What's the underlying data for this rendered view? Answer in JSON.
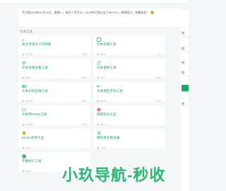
{
  "notice": {
    "text": "今天是2025年07月21日，星期一，农历六月廿七，2025年已经过去了55.07%，继续努力，把握机会！"
  },
  "section": {
    "title": "文本工具"
  },
  "cards": [
    {
      "title": "英文字母大小写转换",
      "views": "117111",
      "likes": "7994"
    },
    {
      "title": "文本去重工具",
      "views": "15941",
      "likes": "6..."
    },
    {
      "title": "文本去重合集工具",
      "views": "9961",
      "likes": "1960"
    },
    {
      "title": "文本替换工具",
      "views": "7541",
      "likes": "1820"
    },
    {
      "title": "文本比较在线工具",
      "views": "115003",
      "likes": "1841"
    },
    {
      "title": "文本相反字号工具",
      "views": "41101",
      "likes": "1917"
    },
    {
      "title": "文本转HTML工具",
      "views": "115941",
      "likes": "1040"
    },
    {
      "title": "网络符号大全",
      "views": "7951",
      "likes": "..."
    },
    {
      "title": "Emoji 表情大全",
      "views": "10181",
      "likes": "..."
    },
    {
      "title": "随机英文姓名器",
      "views": "11401",
      "likes": "..."
    },
    {
      "title": "字数统计工具",
      "views": "4115",
      "likes": "..."
    }
  ],
  "right_panel": {
    "labels": [
      "使",
      "使",
      "使",
      "搜",
      "使"
    ]
  },
  "watermark": {
    "text": "小玖导航-秒收"
  },
  "colors": {
    "accent": "#1fa463",
    "card_bg": "#ffffff",
    "page_bg": "#f5f6f8"
  }
}
